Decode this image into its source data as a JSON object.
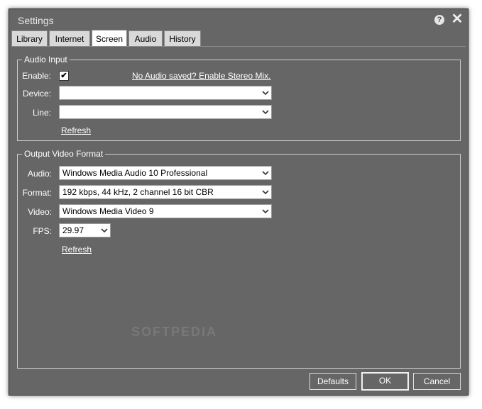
{
  "window": {
    "title": "Settings"
  },
  "tabs": [
    {
      "label": "Library"
    },
    {
      "label": "Internet"
    },
    {
      "label": "Screen",
      "active": true
    },
    {
      "label": "Audio"
    },
    {
      "label": "History"
    }
  ],
  "audio_input": {
    "legend": "Audio Input",
    "enable_label": "Enable:",
    "enable_checked": true,
    "enable_check_glyph": "✔",
    "stereo_mix_link": "No Audio saved? Enable Stereo Mix.",
    "device_label": "Device:",
    "device_value": "",
    "line_label": "Line:",
    "line_value": "",
    "refresh_link": "Refresh"
  },
  "output_video_format": {
    "legend": "Output Video Format",
    "audio_label": "Audio:",
    "audio_value": "Windows Media Audio 10 Professional",
    "format_label": "Format:",
    "format_value": "192 kbps, 44 kHz, 2 channel 16 bit CBR",
    "video_label": "Video:",
    "video_value": "Windows Media Video 9",
    "fps_label": "FPS:",
    "fps_value": "29.97",
    "refresh_link": "Refresh"
  },
  "watermark": "SOFTPEDIA",
  "buttons": {
    "defaults": "Defaults",
    "ok": "OK",
    "cancel": "Cancel"
  },
  "icons": {
    "help": "help-icon",
    "close": "close-icon",
    "dropdown": "chevron-down-icon"
  },
  "colors": {
    "window_bg": "#666666",
    "tab_bg": "#d9d9d9",
    "tab_active_bg": "#ffffff"
  }
}
